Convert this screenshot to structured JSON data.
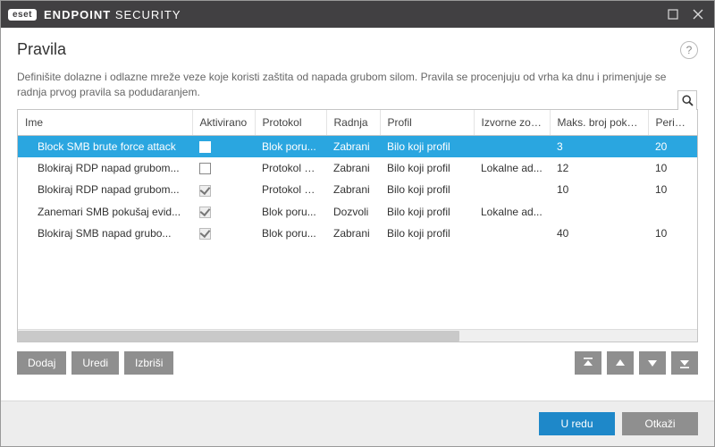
{
  "titlebar": {
    "badge": "eset",
    "product1": "ENDPOINT",
    "product2": "SECURITY"
  },
  "header": {
    "title": "Pravila"
  },
  "description": "Definišite dolazne i odlazne mreže veze koje koristi zaštita od napada grubom silom. Pravila se procenjuju od vrha ka dnu i primenjuje se radnja prvog pravila sa podudaranjem.",
  "columns": {
    "name": "Ime",
    "enabled": "Aktivirano",
    "protocol": "Protokol",
    "action": "Radnja",
    "profile": "Profil",
    "source_zones": "Izvorne zone",
    "max_attempts": "Maks. broj pokušaja",
    "period": "Period..."
  },
  "rows": [
    {
      "name": "Block SMB brute force attack",
      "enabled": false,
      "enabled_editable": true,
      "protocol": "Blok poru...",
      "action": "Zabrani",
      "profile": "Bilo koji profil",
      "source_zones": "",
      "max_attempts": "3",
      "period": "20",
      "selected": true
    },
    {
      "name": "Blokiraj RDP napad grubom...",
      "enabled": false,
      "enabled_editable": true,
      "protocol": "Protokol u...",
      "action": "Zabrani",
      "profile": "Bilo koji profil",
      "source_zones": "Lokalne ad...",
      "max_attempts": "12",
      "period": "10",
      "selected": false
    },
    {
      "name": "Blokiraj RDP napad grubom...",
      "enabled": true,
      "enabled_editable": false,
      "protocol": "Protokol u...",
      "action": "Zabrani",
      "profile": "Bilo koji profil",
      "source_zones": "",
      "max_attempts": "10",
      "period": "10",
      "selected": false
    },
    {
      "name": "Zanemari SMB pokušaj evid...",
      "enabled": true,
      "enabled_editable": false,
      "protocol": "Blok poru...",
      "action": "Dozvoli",
      "profile": "Bilo koji profil",
      "source_zones": "Lokalne ad...",
      "max_attempts": "",
      "period": "",
      "selected": false
    },
    {
      "name": "Blokiraj SMB napad grubo...",
      "enabled": true,
      "enabled_editable": false,
      "protocol": "Blok poru...",
      "action": "Zabrani",
      "profile": "Bilo koji profil",
      "source_zones": "",
      "max_attempts": "40",
      "period": "10",
      "selected": false
    }
  ],
  "buttons": {
    "add": "Dodaj",
    "edit": "Uredi",
    "delete": "Izbriši",
    "ok": "U redu",
    "cancel": "Otkaži"
  }
}
